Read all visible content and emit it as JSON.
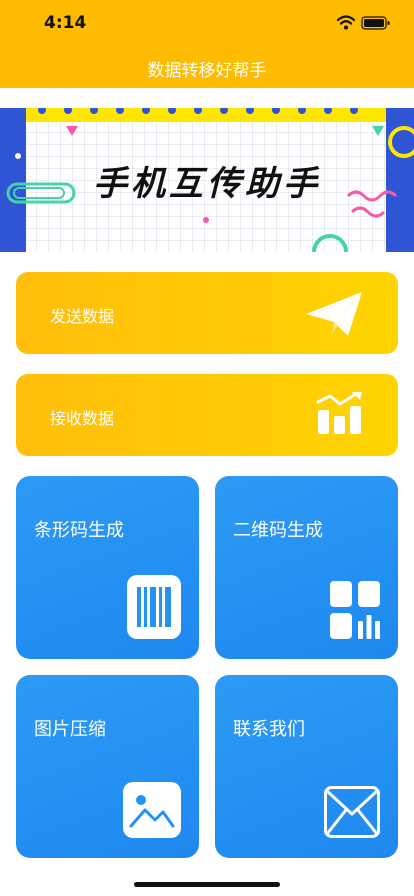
{
  "status_bar": {
    "time": "4:14"
  },
  "header": {
    "title": "数据转移好帮手"
  },
  "banner": {
    "title": "手机互传助手"
  },
  "actions": {
    "send": {
      "label": "发送数据",
      "icon": "paper-plane-icon"
    },
    "receive": {
      "label": "接收数据",
      "icon": "bar-chart-icon"
    }
  },
  "tools": {
    "barcode": {
      "label": "条形码生成",
      "icon": "barcode-icon"
    },
    "qrcode": {
      "label": "二维码生成",
      "icon": "qr-code-icon"
    },
    "compress": {
      "label": "图片压缩",
      "icon": "image-icon"
    },
    "contact": {
      "label": "联系我们",
      "icon": "mail-icon"
    }
  },
  "colors": {
    "header": "#FFBB00",
    "yellow_card": "#FFC60A",
    "blue_tile": "#2392F3"
  }
}
